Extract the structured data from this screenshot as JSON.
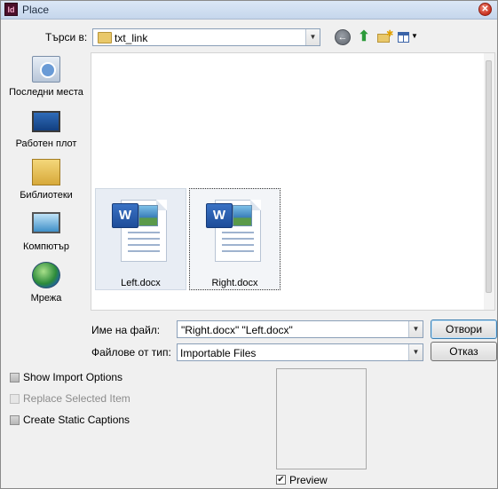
{
  "window": {
    "title": "Place",
    "app_icon": "Id"
  },
  "lookin": {
    "label": "Търси в:",
    "folder": "txt_link"
  },
  "places": [
    {
      "label": "Последни места",
      "icon": "recent-places-icon"
    },
    {
      "label": "Работен плот",
      "icon": "desktop-icon"
    },
    {
      "label": "Библиотеки",
      "icon": "libraries-icon"
    },
    {
      "label": "Компютър",
      "icon": "computer-icon"
    },
    {
      "label": "Мрежа",
      "icon": "network-icon"
    }
  ],
  "files": [
    {
      "name": "Left.docx",
      "icon": "word-document-icon",
      "badge": "W"
    },
    {
      "name": "Right.docx",
      "icon": "word-document-icon",
      "badge": "W"
    }
  ],
  "filename": {
    "label": "Име на файл:",
    "value": "\"Right.docx\" \"Left.docx\""
  },
  "filetype": {
    "label": "Файлове от тип:",
    "value": "Importable Files"
  },
  "buttons": {
    "open": "Отвори",
    "cancel": "Отказ"
  },
  "options": [
    {
      "label": "Show Import Options",
      "enabled": true,
      "checked": false
    },
    {
      "label": "Replace Selected Item",
      "enabled": false,
      "checked": false
    },
    {
      "label": "Create Static Captions",
      "enabled": true,
      "checked": false
    }
  ],
  "preview": {
    "label": "Preview",
    "checked": true
  }
}
